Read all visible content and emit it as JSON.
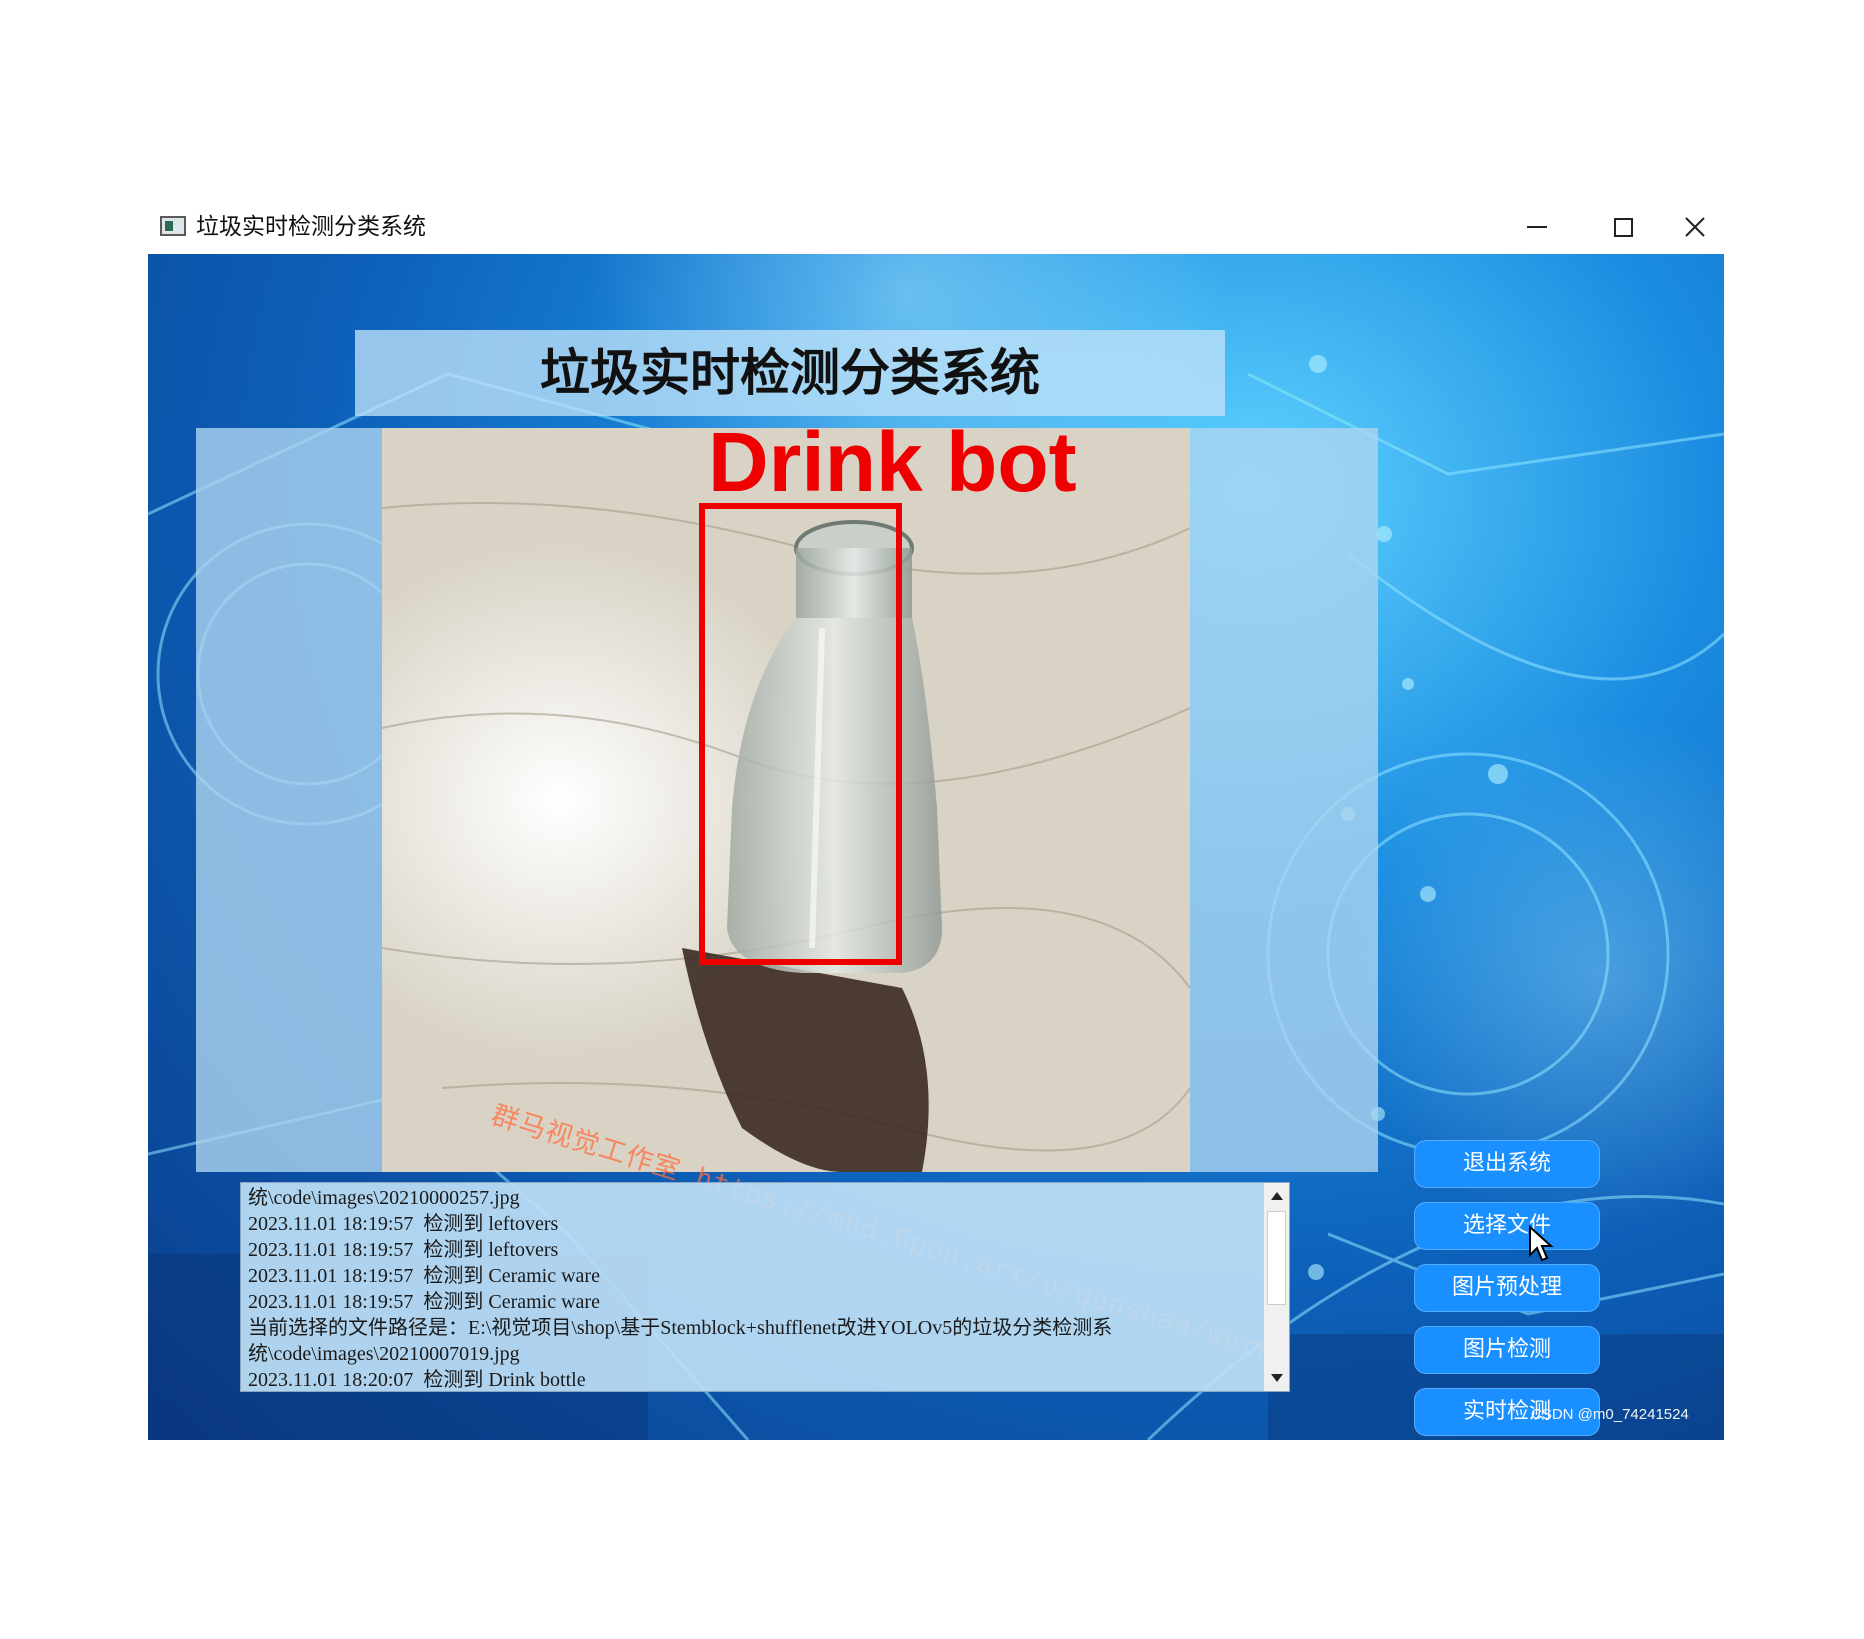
{
  "window": {
    "title": "垃圾实时检测分类系统",
    "controls": {
      "minimize": "minimize",
      "maximize": "maximize",
      "close": "close"
    }
  },
  "banner": {
    "title": "垃圾实时检测分类系统"
  },
  "display": {
    "detection_label": "Drink  bot",
    "watermark": "群马视觉工作室 https://mbd.6pen.art/o/qunshan/work"
  },
  "log": {
    "lines": [
      "统\\code\\images\\20210000257.jpg",
      "2023.11.01 18:19:57  检测到 leftovers",
      "2023.11.01 18:19:57  检测到 leftovers",
      "2023.11.01 18:19:57  检测到 Ceramic ware",
      "2023.11.01 18:19:57  检测到 Ceramic ware",
      "当前选择的文件路径是：E:\\视觉项目\\shop\\基于Stemblock+shufflenet改进YOLOv5的垃圾分类检测系",
      "统\\code\\images\\20210007019.jpg",
      "2023.11.01 18:20:07  检测到 Drink bottle"
    ]
  },
  "buttons": {
    "exit": "退出系统",
    "select_file": "选择文件",
    "preprocess": "图片预处理",
    "detect_image": "图片检测",
    "realtime": "实时检测"
  },
  "footer": {
    "csdn": "CSDN @m0_74241524"
  },
  "colors": {
    "button_bg": "#1a8fff",
    "bbox": "#ee0000",
    "background": "#0d5fb8"
  }
}
